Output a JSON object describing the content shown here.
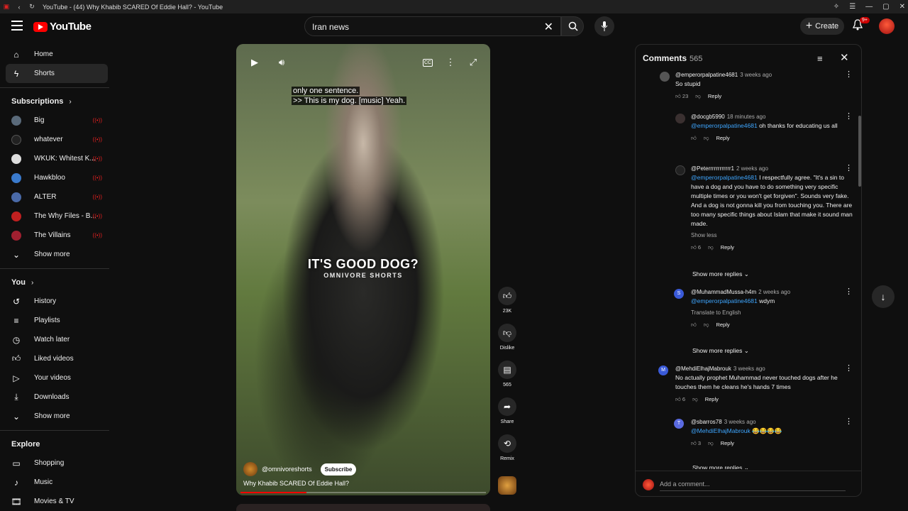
{
  "window": {
    "title": "YouTube - (44) Why Khabib SCARED Of Eddie Hall? - YouTube"
  },
  "header": {
    "logo_text": "YouTube",
    "search_value": "Iran news",
    "create_label": "Create",
    "notification_badge": "9+"
  },
  "sidebar": {
    "main": [
      {
        "label": "Home",
        "icon": "home-icon"
      },
      {
        "label": "Shorts",
        "icon": "shorts-icon",
        "active": true
      }
    ],
    "subscriptions_title": "Subscriptions",
    "subscriptions": [
      {
        "label": "Big",
        "color": "#5a6a7a"
      },
      {
        "label": "whatever",
        "color": "#222222"
      },
      {
        "label": "WKUK: Whitest K...",
        "color": "#dddddd"
      },
      {
        "label": "Hawkbloo",
        "color": "#3a7acc"
      },
      {
        "label": "ALTER",
        "color": "#4a6aa8"
      },
      {
        "label": "The Why Files - B...",
        "color": "#c02020"
      },
      {
        "label": "The Villains",
        "color": "#a02030"
      }
    ],
    "show_more_1": "Show more",
    "you_title": "You",
    "you_items": [
      {
        "label": "History",
        "icon": "history-icon"
      },
      {
        "label": "Playlists",
        "icon": "playlists-icon"
      },
      {
        "label": "Watch later",
        "icon": "watch-later-icon"
      },
      {
        "label": "Liked videos",
        "icon": "like-icon"
      },
      {
        "label": "Your videos",
        "icon": "your-videos-icon"
      },
      {
        "label": "Downloads",
        "icon": "download-icon"
      }
    ],
    "show_more_2": "Show more",
    "explore_title": "Explore",
    "explore_items": [
      {
        "label": "Shopping",
        "icon": "shopping-icon"
      },
      {
        "label": "Music",
        "icon": "music-icon"
      },
      {
        "label": "Movies & TV",
        "icon": "movies-icon"
      }
    ]
  },
  "video": {
    "caption_line1": "only one sentence.",
    "caption_line2": ">> This is my dog. [music] Yeah.",
    "overlay_text": "IT'S GOOD DOG?",
    "overlay_sub": "OMNIVORE SHORTS",
    "channel": "@omnivoreshorts",
    "subscribe_label": "Subscribe",
    "title": "Why Khabib SCARED Of Eddie Hall?",
    "progress": 0.27,
    "cc_label": "CC"
  },
  "actions": {
    "likes": "23K",
    "dislike_label": "Dislike",
    "comments_count": "565",
    "share_label": "Share",
    "remix_label": "Remix"
  },
  "comments": {
    "title": "Comments",
    "count": "565",
    "add_placeholder": "Add a comment...",
    "reply_label": "Reply",
    "items": [
      {
        "handle": "@emperorpalpatine4681",
        "time": "3 weeks ago",
        "text": "So stupid",
        "likes": "23"
      },
      {
        "handle": "@docgb5990",
        "time": "18 minutes ago",
        "mention": "@emperorpalpatine4681",
        "text": " oh thanks for educating us all",
        "likes": ""
      },
      {
        "handle": "@Peterrrrrrrrrrrr1",
        "time": "2 weeks ago",
        "mention": "@emperorpalpatine4681",
        "text": " I respectfully agree. \"It's a sin to have a dog and you have to do something very specific multiple times or you won't get forgiven\". Sounds very fake. And a dog is not gonna  kill you from touching you. There are too many specific things about Islam that make it sound man made.",
        "likes": "6",
        "show_less": "Show less"
      },
      {
        "handle": "@MuhammadMussa-h4m",
        "time": "2 weeks ago",
        "mention": "@emperorpalpatine4681",
        "text": " wdym",
        "translate": "Translate to English",
        "likes": "",
        "avatar": "S"
      },
      {
        "handle": "@MehdiElhajMabrouk",
        "time": "3 weeks ago",
        "text": "No actually prophet Muhammad never touched dogs after he touches them he cleans he's hands 7 times",
        "likes": "6",
        "avatar": "M"
      },
      {
        "handle": "@sbarros78",
        "time": "3 weeks ago",
        "mention": "@MehdiElhajMabrouk",
        "text": " 😂😂😂😂",
        "likes": "3",
        "avatar": "T"
      }
    ],
    "show_more_replies": "Show more replies"
  },
  "colors": {
    "brand_red": "#ff0000",
    "link_blue": "#3ea6ff",
    "background": "#0f0f0f"
  }
}
